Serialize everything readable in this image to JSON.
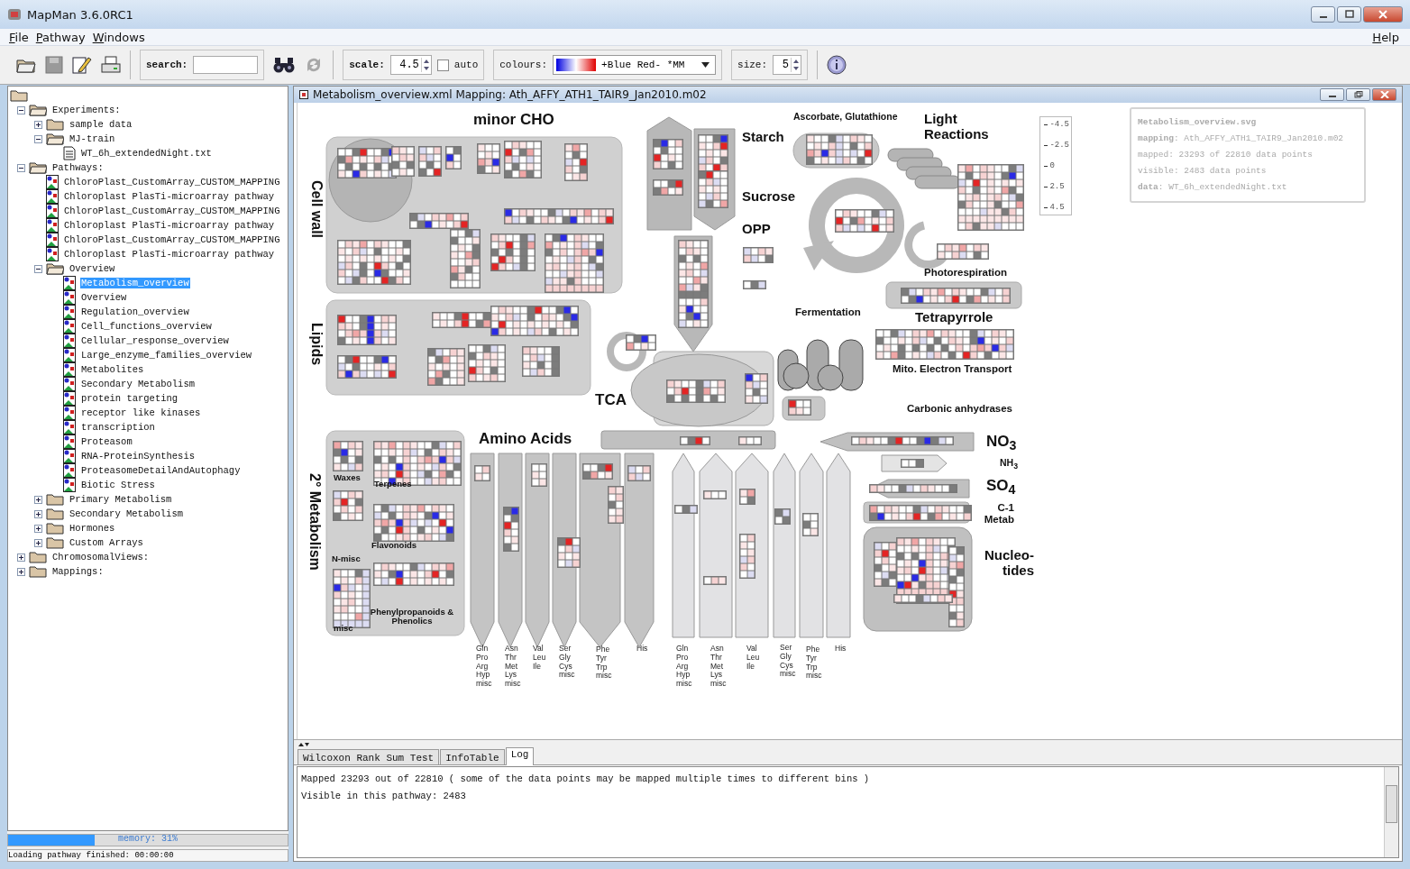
{
  "window": {
    "title": "MapMan 3.6.0RC1"
  },
  "menu": [
    {
      "label": "File"
    },
    {
      "label": "Pathway"
    },
    {
      "label": "Windows"
    }
  ],
  "help": "Help",
  "toolbar": {
    "search": {
      "label": "search:"
    },
    "scale": {
      "label": "scale:",
      "value": "4.5"
    },
    "auto": {
      "label": "auto",
      "checked": false
    },
    "colours": {
      "label": "colours:",
      "value": "+Blue Red- *MM"
    },
    "size": {
      "label": "size:",
      "value": "5"
    }
  },
  "tree": [
    {
      "label": "Experiments:",
      "kind": "folder",
      "expanded": true,
      "selected": false,
      "children": [
        {
          "label": "sample data",
          "kind": "folder",
          "expanded": false,
          "selected": false
        },
        {
          "label": "MJ-train",
          "kind": "folder",
          "expanded": true,
          "selected": false,
          "children": [
            {
              "label": "WT_6h_extendedNight.txt",
              "kind": "file",
              "selected": false
            }
          ]
        }
      ]
    },
    {
      "label": "Pathways:",
      "kind": "folder",
      "expanded": true,
      "selected": false,
      "children": [
        {
          "label": "ChloroPlast_CustomArray_CUSTOM_MAPPING",
          "kind": "pathway",
          "selected": false
        },
        {
          "label": "Chloroplast PlasTi-microarray pathway",
          "kind": "pathway",
          "selected": false
        },
        {
          "label": "ChloroPlast_CustomArray_CUSTOM_MAPPING",
          "kind": "pathway",
          "selected": false
        },
        {
          "label": "Chloroplast PlasTi-microarray pathway",
          "kind": "pathway",
          "selected": false
        },
        {
          "label": "ChloroPlast_CustomArray_CUSTOM_MAPPING",
          "kind": "pathway",
          "selected": false
        },
        {
          "label": "Chloroplast PlasTi-microarray pathway",
          "kind": "pathway",
          "selected": false
        },
        {
          "label": "Overview",
          "kind": "folder",
          "expanded": true,
          "selected": false,
          "children": [
            {
              "label": "Metabolism_overview",
              "kind": "pathway",
              "selected": true
            },
            {
              "label": "Overview",
              "kind": "pathway",
              "selected": false
            },
            {
              "label": "Regulation_overview",
              "kind": "pathway",
              "selected": false
            },
            {
              "label": "Cell_functions_overview",
              "kind": "pathway",
              "selected": false
            },
            {
              "label": "Cellular_response_overview",
              "kind": "pathway",
              "selected": false
            },
            {
              "label": "Large_enzyme_families_overview",
              "kind": "pathway",
              "selected": false
            },
            {
              "label": "Metabolites",
              "kind": "pathway",
              "selected": false
            },
            {
              "label": "Secondary Metabolism",
              "kind": "pathway",
              "selected": false
            },
            {
              "label": "protein targeting",
              "kind": "pathway",
              "selected": false
            },
            {
              "label": "receptor like kinases",
              "kind": "pathway",
              "selected": false
            },
            {
              "label": "transcription",
              "kind": "pathway",
              "selected": false
            },
            {
              "label": "Proteasom",
              "kind": "pathway",
              "selected": false
            },
            {
              "label": "RNA-ProteinSynthesis",
              "kind": "pathway",
              "selected": false
            },
            {
              "label": "ProteasomeDetailAndAutophagy",
              "kind": "pathway",
              "selected": false
            },
            {
              "label": "Biotic Stress",
              "kind": "pathway",
              "selected": false
            }
          ]
        },
        {
          "label": "Primary Metabolism",
          "kind": "folder",
          "expanded": false,
          "selected": false
        },
        {
          "label": "Secondary Metabolism",
          "kind": "folder",
          "expanded": false,
          "selected": false
        },
        {
          "label": "Hormones",
          "kind": "folder",
          "expanded": false,
          "selected": false
        },
        {
          "label": "Custom Arrays",
          "kind": "folder",
          "expanded": false,
          "selected": false
        }
      ]
    },
    {
      "label": "ChromosomalViews:",
      "kind": "folder",
      "expanded": false,
      "selected": false
    },
    {
      "label": "Mappings:",
      "kind": "folder",
      "expanded": false,
      "selected": false
    }
  ],
  "memory": {
    "label": "memory: 31%",
    "level": 0.31
  },
  "status": "Loading pathway finished: 00:00:00",
  "frame": {
    "title": "Metabolism_overview.xml Mapping: Ath_AFFY_ATH1_TAIR9_Jan2010.m02"
  },
  "diagram": {
    "labels": [
      {
        "text": "minor CHO",
        "kind": "title"
      },
      {
        "text": "Cell wall",
        "kind": "vertical"
      },
      {
        "text": "Lipids",
        "kind": "vertical"
      },
      {
        "text": "2° Metabolism",
        "kind": "vertical"
      },
      {
        "text": "Starch",
        "kind": "section"
      },
      {
        "text": "Sucrose",
        "kind": "section"
      },
      {
        "text": "OPP",
        "kind": "section"
      },
      {
        "text": "Ascorbate, Glutathione",
        "kind": "small"
      },
      {
        "text": "Light Reactions",
        "kind": "section"
      },
      {
        "text": "Photorespiration",
        "kind": "sub"
      },
      {
        "text": "Fermentation",
        "kind": "sub"
      },
      {
        "text": "Tetrapyrrole",
        "kind": "section"
      },
      {
        "text": "Mito. Electron Transport",
        "kind": "sub"
      },
      {
        "text": "TCA",
        "kind": "title"
      },
      {
        "text": "Carbonic anhydrases",
        "kind": "sub"
      },
      {
        "text": "Amino Acids",
        "kind": "title"
      },
      {
        "text": "NO$_{3}$",
        "kind": "title"
      },
      {
        "text": "NH$_{3}$",
        "kind": "small"
      },
      {
        "text": "SO$_{4}$",
        "kind": "title"
      },
      {
        "text": "C-1 Metab",
        "kind": "sub"
      },
      {
        "text": "Nucleo-tides",
        "kind": "section"
      },
      {
        "text": "Waxes",
        "kind": "tiny"
      },
      {
        "text": "Terpenes",
        "kind": "tiny"
      },
      {
        "text": "Flavonoids",
        "kind": "tiny"
      },
      {
        "text": "N-misc",
        "kind": "tiny"
      },
      {
        "text": "Phenylpropanoids & Phenolics",
        "kind": "tiny"
      },
      {
        "text": "misc",
        "kind": "tiny"
      }
    ],
    "amino_acid_groups": [
      "Gln Pro Arg Hyp misc",
      "Asn Thr Met Lys misc",
      "Val Leu Ile",
      "Ser Gly Cys misc",
      "Phe Tyr Trp misc",
      "His",
      "Gln Pro Arg Hyp misc",
      "Asn Thr Met Lys misc",
      "Val Leu Ile",
      "Ser Gly Cys misc",
      "Phe Tyr Trp misc",
      "His"
    ]
  },
  "legend": {
    "ticks": [
      "-4.5",
      "-2.5",
      "0",
      "2.5",
      "4.5"
    ]
  },
  "info": {
    "lines": [
      "**Metabolism_overview.svg**",
      "**mapping**: Ath_AFFY_ATH1_TAIR9_Jan2010.m02",
      "mapped: 23293 of 22810 data points",
      "visible: 2483 data points",
      "**data**: WT_6h_extendedNight.txt"
    ]
  },
  "tabs": [
    {
      "label": "Wilcoxon Rank Sum Test",
      "selected": false
    },
    {
      "label": "InfoTable",
      "selected": false
    },
    {
      "label": "Log",
      "selected": true
    }
  ],
  "log": [
    "Mapped 23293 out of 22810 ( some of the data points may be mapped multiple times to different bins )",
    "Visible in this pathway: 2483"
  ]
}
